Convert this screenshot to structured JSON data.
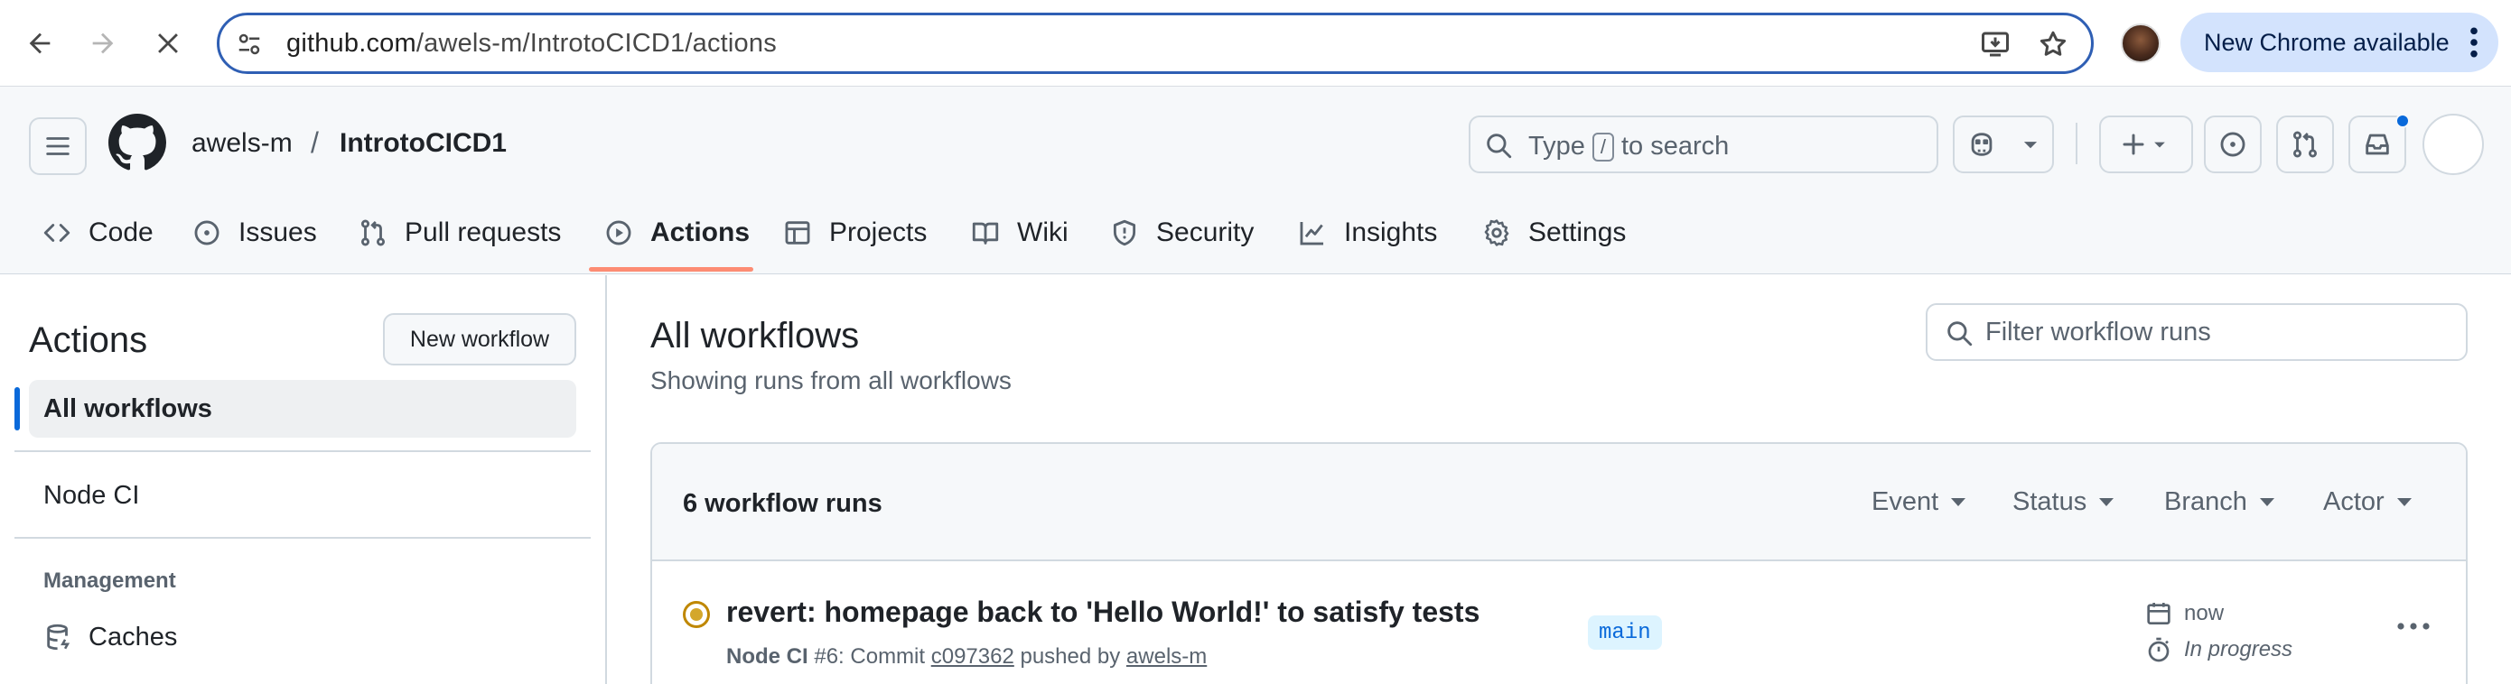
{
  "browser": {
    "url_host": "github.com",
    "url_path": "/awels-m/IntrotoCICD1/actions",
    "update_label": "New Chrome available"
  },
  "header": {
    "owner": "awels-m",
    "separator": "/",
    "repo": "IntrotoCICD1",
    "search_prefix": "Type",
    "search_key": "/",
    "search_suffix": "to search"
  },
  "tabs": [
    {
      "label": "Code",
      "icon": "code-icon"
    },
    {
      "label": "Issues",
      "icon": "issue-icon"
    },
    {
      "label": "Pull requests",
      "icon": "pull-request-icon"
    },
    {
      "label": "Actions",
      "icon": "play-icon",
      "active": true
    },
    {
      "label": "Projects",
      "icon": "table-icon"
    },
    {
      "label": "Wiki",
      "icon": "book-icon"
    },
    {
      "label": "Security",
      "icon": "shield-icon"
    },
    {
      "label": "Insights",
      "icon": "graph-icon"
    },
    {
      "label": "Settings",
      "icon": "gear-icon"
    }
  ],
  "sidebar": {
    "title": "Actions",
    "new_workflow": "New workflow",
    "items": [
      {
        "label": "All workflows",
        "active": true
      },
      {
        "label": "Node CI"
      }
    ],
    "section": "Management",
    "caches": "Caches"
  },
  "main": {
    "title": "All workflows",
    "subtitle": "Showing runs from all workflows",
    "filter_placeholder": "Filter workflow runs",
    "runs_count": "6 workflow runs",
    "filters": [
      "Event",
      "Status",
      "Branch",
      "Actor"
    ],
    "runs": [
      {
        "title": "revert: homepage back to 'Hello World!' to satisfy tests",
        "workflow": "Node CI",
        "run_number": "#6",
        "commit_prefix": ": Commit",
        "commit": "c097362",
        "pushed_by": "pushed by",
        "actor": "awels-m",
        "branch": "main",
        "time": "now",
        "duration": "In progress",
        "status": "in-progress"
      }
    ]
  },
  "colors": {
    "accent": "#0969da",
    "tab_underline": "#fd8c73",
    "in_progress": "#bf8700",
    "omnibox_border": "#2f5fb4"
  }
}
